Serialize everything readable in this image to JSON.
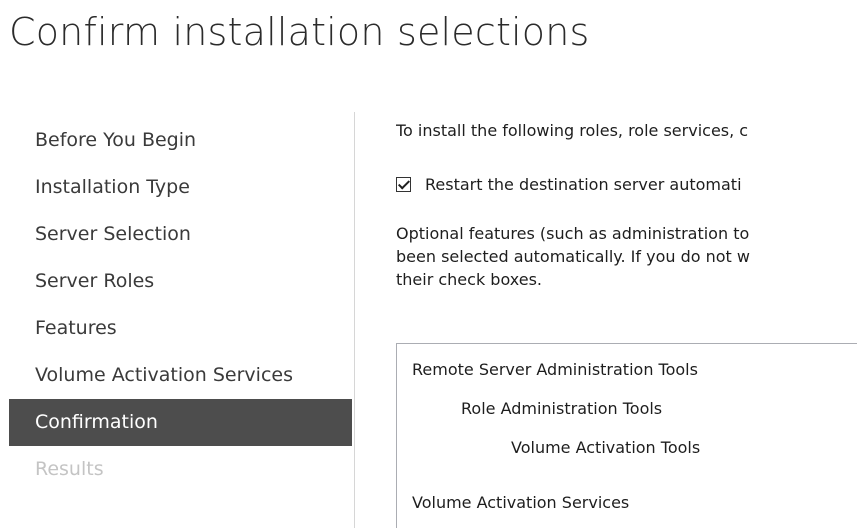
{
  "page": {
    "title": "Confirm installation selections"
  },
  "sidebar": {
    "items": [
      {
        "label": "Before You Begin",
        "state": "normal"
      },
      {
        "label": "Installation Type",
        "state": "normal"
      },
      {
        "label": "Server Selection",
        "state": "normal"
      },
      {
        "label": "Server Roles",
        "state": "normal"
      },
      {
        "label": "Features",
        "state": "normal"
      },
      {
        "label": "Volume Activation Services",
        "state": "normal"
      },
      {
        "label": "Confirmation",
        "state": "active"
      },
      {
        "label": "Results",
        "state": "disabled"
      }
    ]
  },
  "main": {
    "intro": "To install the following roles, role services, c",
    "restart_checkbox": {
      "checked": true,
      "label": "Restart the destination server automati"
    },
    "optional_lines": [
      "Optional features (such as administration to",
      "been selected automatically. If you do not w",
      "their check boxes."
    ],
    "selection_list": [
      {
        "label": "Remote Server Administration Tools",
        "level": 0
      },
      {
        "label": "Role Administration Tools",
        "level": 1
      },
      {
        "label": "Volume Activation Tools",
        "level": 2
      },
      {
        "label": "Volume Activation Services",
        "level": 0
      }
    ]
  },
  "colors": {
    "active_nav_background": "#4d4d4d",
    "active_nav_text": "#ffffff",
    "disabled_nav_text": "#c4c4c4",
    "body_text": "#1e1e1e"
  }
}
